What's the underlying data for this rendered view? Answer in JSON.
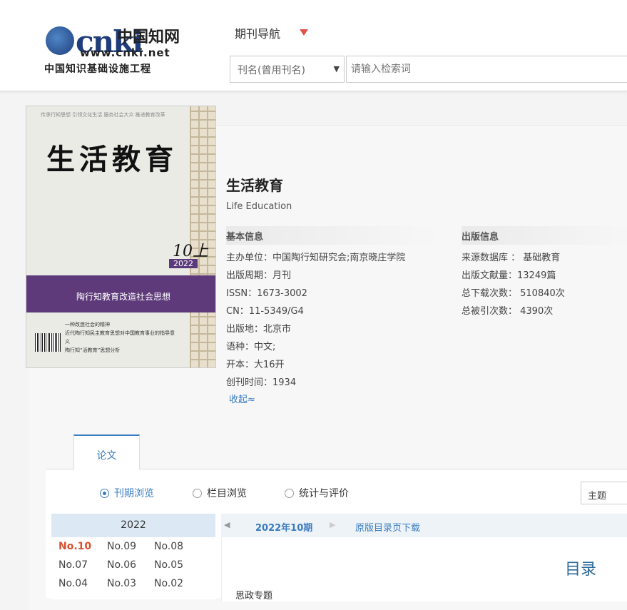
{
  "header": {
    "logo": {
      "mark": "cnki",
      "chinese": "中国知网",
      "url": "www.cnki.net",
      "slogan": "中国知识基础设施工程"
    },
    "nav_label": "期刊导航",
    "search": {
      "field_select": "刊名(曾用刊名)",
      "placeholder": "请输入检索词"
    }
  },
  "journal": {
    "cover": {
      "top_line": "传承行知思想  引领文化生活  服务社会大众  推进教育改革",
      "title": "生活教育",
      "issue": "10上",
      "year": "2022",
      "band_text": "陶行知教育改造社会思想",
      "lines": [
        "一种改造社会的精神",
        "近代陶行知民主教育思想对中国教育事业的指导意义",
        "陶行知“活教育”思想分析"
      ]
    },
    "title": "生活教育",
    "title_en": "Life Education",
    "basic": {
      "heading": "基本信息",
      "items": [
        "主办单位：中国陶行知研究会;南京晓庄学院",
        "出版周期：月刊",
        "ISSN：1673-3002",
        "CN：11-5349/G4",
        "出版地：北京市",
        "语种：中文;",
        "开本：大16开",
        "创刊时间：1934"
      ]
    },
    "publish": {
      "heading": "出版信息",
      "items": [
        "来源数据库 ： 基础教育",
        "出版文献量：13249篇",
        "总下载次数： 510840次",
        "总被引次数： 4390次"
      ]
    },
    "collapse_label": "收起≈"
  },
  "tabs": {
    "papers": "论文"
  },
  "browse": {
    "options": [
      {
        "label": "刊期浏览",
        "selected": true
      },
      {
        "label": "栏目浏览",
        "selected": false
      },
      {
        "label": "统计与评价",
        "selected": false
      }
    ],
    "topic_select": "主题",
    "year": "2022",
    "issues": [
      "No.10",
      "No.09",
      "No.08",
      "No.07",
      "No.06",
      "No.05",
      "No.04",
      "No.03",
      "No.02"
    ],
    "current_issue": "No.10",
    "issue_bar": {
      "current": "2022年10期",
      "download": "原版目录页下载"
    },
    "toc_title": "目录",
    "toc_first": "思政专题"
  },
  "colors": {
    "accent": "#3a7cc0",
    "current_issue": "#d9502f",
    "cover_band": "#5e3a7a",
    "nav_arrow": "#e0524a"
  }
}
